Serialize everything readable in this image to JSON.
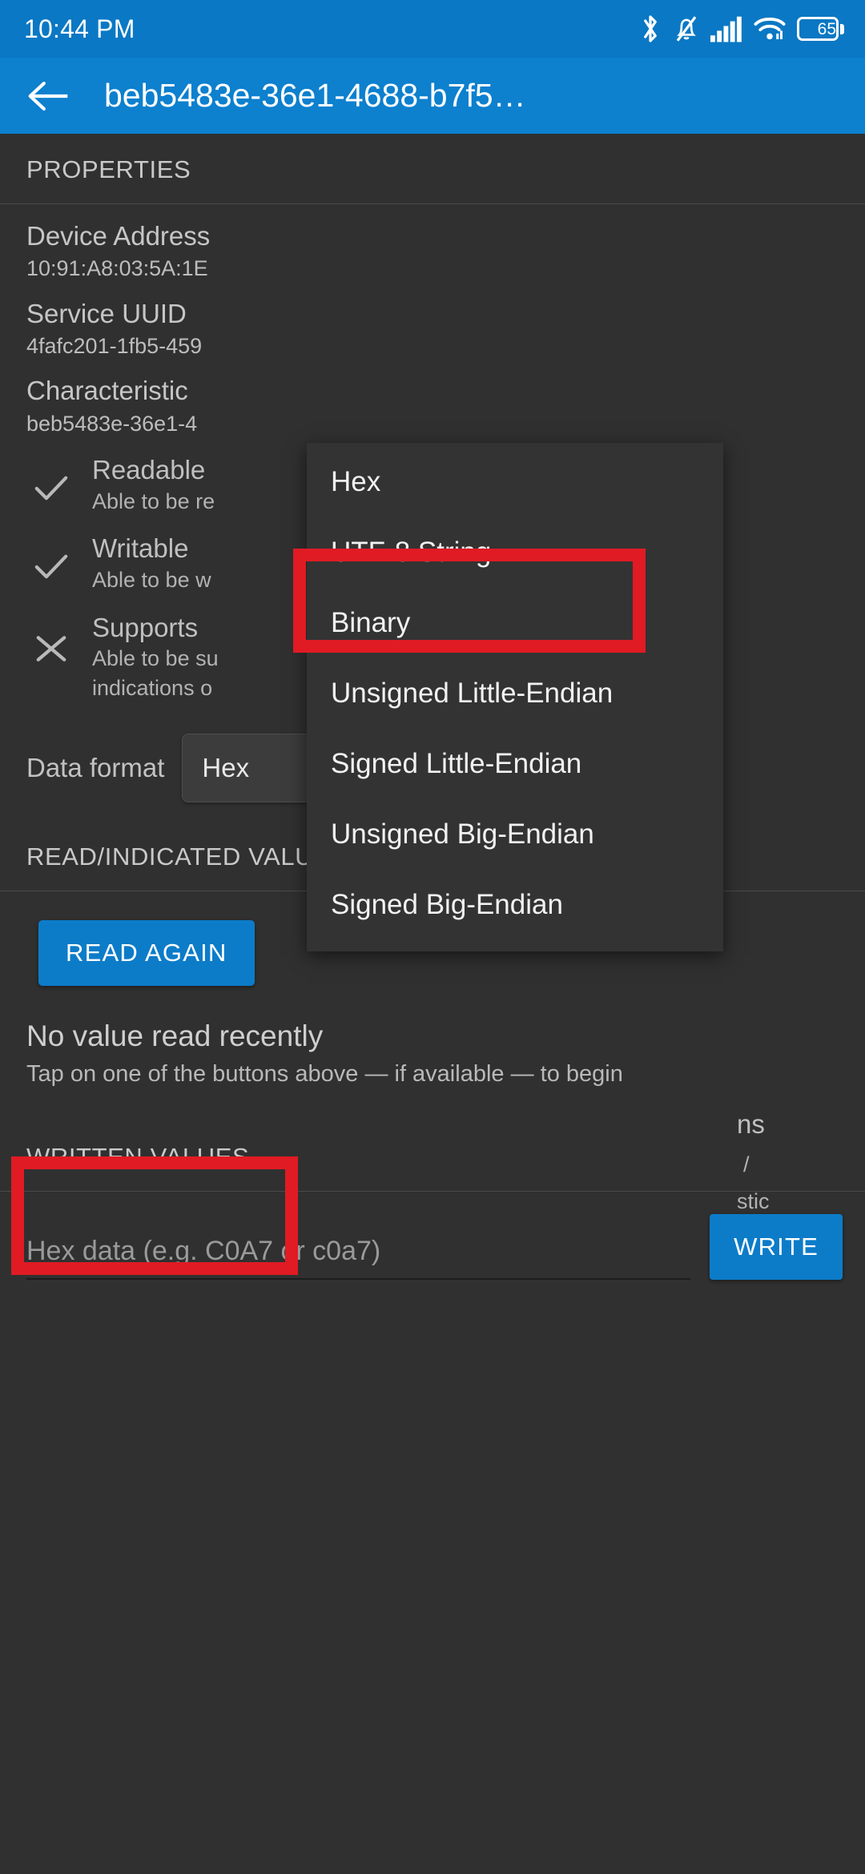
{
  "statusbar": {
    "time": "10:44 PM",
    "icons": [
      "bluetooth-icon",
      "bell-muted-icon",
      "signal-bars-icon",
      "wifi-icon",
      "battery-icon"
    ],
    "battery_percent": "65"
  },
  "appbar": {
    "back_label": "back-arrow",
    "title": "beb5483e-36e1-4688-b7f5…",
    "background": "#0d80ce"
  },
  "sections": {
    "properties_header": "PROPERTIES",
    "read_header": "READ/INDICATED VALUES",
    "written_header": "WRITTEN VALUES"
  },
  "properties": [
    {
      "title": "Device Address",
      "value": "10:91:A8:03:5A:1E"
    },
    {
      "title": "Service UUID",
      "value": "4fafc201-1fb5-459"
    },
    {
      "title": "Characteristic",
      "value": "beb5483e-36e1-4"
    }
  ],
  "flags": [
    {
      "mark": "check-icon",
      "title": "Readable",
      "desc": "Able to be re"
    },
    {
      "mark": "check-icon",
      "title": "Writable",
      "desc": "Able to be w"
    },
    {
      "mark": "cross-icon",
      "title": "Supports",
      "title_tail": "ns",
      "desc": "Able to be su",
      "desc2": "indications o",
      "desc_tail1": "/",
      "desc_tail2": "stic"
    }
  ],
  "data_format": {
    "label": "Data format",
    "selected": "Hex",
    "caret": "chevron-down-icon"
  },
  "dropdown": {
    "open": true,
    "selected_index": 1,
    "options": [
      "Hex",
      "UTF-8 String",
      "Binary",
      "Unsigned Little-Endian",
      "Signed Little-Endian",
      "Unsigned Big-Endian",
      "Signed Big-Endian"
    ]
  },
  "read_section": {
    "button_label": "READ AGAIN",
    "empty_title": "No value read recently",
    "empty_sub": "Tap on one of the buttons above — if available — to begin"
  },
  "write_section": {
    "input_placeholder": "Hex data (e.g. C0A7 or c0a7)",
    "button_label": "WRITE"
  },
  "annotations": {
    "color": "#e01b24",
    "boxes": [
      "utf-8-string-option",
      "data-format-label"
    ]
  },
  "colors": {
    "accent": "#0c7cc9",
    "appbar": "#0d80ce",
    "statusbar": "#0a78c4",
    "background": "#303030",
    "menu": "#333333",
    "highlight": "#e01b24"
  }
}
